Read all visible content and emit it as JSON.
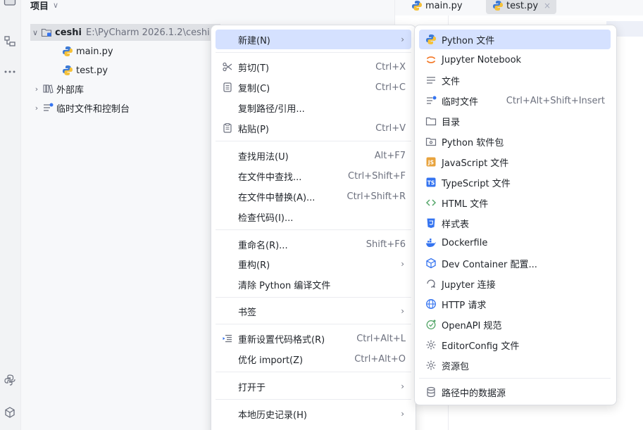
{
  "project_panel": {
    "title": "项目",
    "tree": [
      {
        "label": "ceshi",
        "path": "E:\\PyCharm 2026.1.2\\ceshi"
      },
      {
        "label": "main.py"
      },
      {
        "label": "test.py"
      },
      {
        "label": "外部库"
      },
      {
        "label": "临时文件和控制台"
      }
    ]
  },
  "editor": {
    "tabs": [
      {
        "label": "main.py"
      },
      {
        "label": "test.py",
        "close": "×"
      }
    ]
  },
  "context_menu": {
    "items": [
      {
        "label": "新建(N)",
        "shortcut": "",
        "submenu": "›"
      },
      {
        "label": "剪切(T)",
        "shortcut": "Ctrl+X"
      },
      {
        "label": "复制(C)",
        "shortcut": "Ctrl+C"
      },
      {
        "label": "复制路径/引用...",
        "shortcut": ""
      },
      {
        "label": "粘贴(P)",
        "shortcut": "Ctrl+V"
      },
      {
        "label": "查找用法(U)",
        "shortcut": "Alt+F7"
      },
      {
        "label": "在文件中查找...",
        "shortcut": "Ctrl+Shift+F"
      },
      {
        "label": "在文件中替换(A)...",
        "shortcut": "Ctrl+Shift+R"
      },
      {
        "label": "检查代码(I)...",
        "shortcut": ""
      },
      {
        "label": "重命名(R)...",
        "shortcut": "Shift+F6"
      },
      {
        "label": "重构(R)",
        "shortcut": "",
        "submenu": "›"
      },
      {
        "label": "清除 Python 编译文件",
        "shortcut": ""
      },
      {
        "label": "书签",
        "shortcut": "",
        "submenu": "›"
      },
      {
        "label": "重新设置代码格式(R)",
        "shortcut": "Ctrl+Alt+L"
      },
      {
        "label": "优化 import(Z)",
        "shortcut": "Ctrl+Alt+O"
      },
      {
        "label": "打开于",
        "shortcut": "",
        "submenu": "›"
      },
      {
        "label": "本地历史记录(H)",
        "shortcut": "",
        "submenu": "›"
      }
    ]
  },
  "new_submenu": {
    "items": [
      {
        "label": "Python 文件",
        "icon": "python-icon"
      },
      {
        "label": "Jupyter Notebook",
        "icon": "jupyter-icon"
      },
      {
        "label": "文件",
        "icon": "text-file-icon"
      },
      {
        "label": "临时文件",
        "shortcut": "Ctrl+Alt+Shift+Insert",
        "icon": "scratch-file-icon"
      },
      {
        "label": "目录",
        "icon": "folder-icon"
      },
      {
        "label": "Python 软件包",
        "icon": "package-icon"
      },
      {
        "label": "JavaScript 文件",
        "icon": "javascript-icon"
      },
      {
        "label": "TypeScript 文件",
        "icon": "typescript-icon"
      },
      {
        "label": "HTML 文件",
        "icon": "html-icon"
      },
      {
        "label": "样式表",
        "icon": "css-icon"
      },
      {
        "label": "Dockerfile",
        "icon": "docker-icon"
      },
      {
        "label": "Dev Container 配置...",
        "icon": "dev-container-icon"
      },
      {
        "label": "Jupyter 连接",
        "icon": "jupyter-connection-icon"
      },
      {
        "label": "HTTP 请求",
        "icon": "globe-icon"
      },
      {
        "label": "OpenAPI 规范",
        "icon": "openapi-icon"
      },
      {
        "label": "EditorConfig 文件",
        "icon": "gear-icon"
      },
      {
        "label": "资源包",
        "icon": "resource-bundle-icon"
      },
      {
        "label": "路径中的数据源",
        "icon": "database-icon"
      }
    ]
  }
}
